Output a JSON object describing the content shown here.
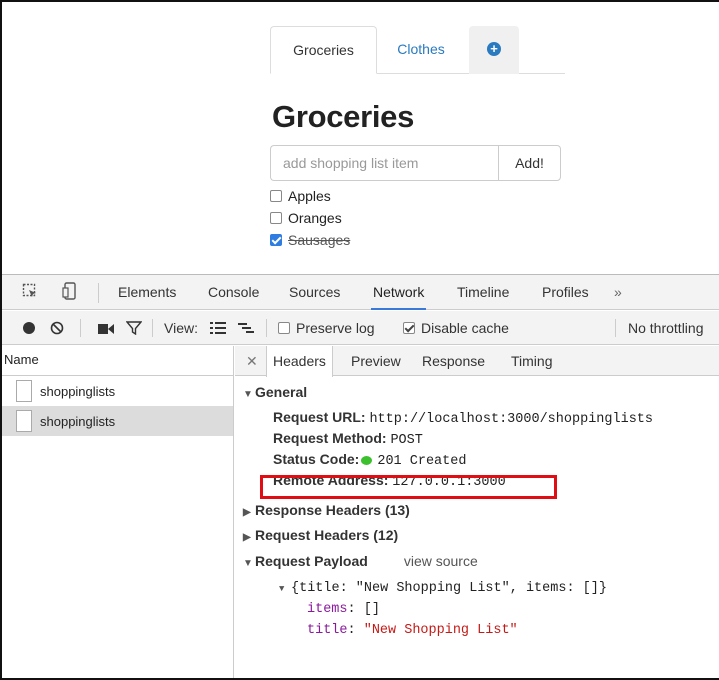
{
  "app": {
    "tabs": [
      {
        "label": "Groceries",
        "active": true
      },
      {
        "label": "Clothes",
        "active": false
      }
    ],
    "add_tab_icon": "plus-circle-icon",
    "title": "Groceries",
    "input_placeholder": "add shopping list item",
    "add_button": "Add!",
    "items": [
      {
        "label": "Apples",
        "checked": false
      },
      {
        "label": "Oranges",
        "checked": false
      },
      {
        "label": "Sausages",
        "checked": true
      }
    ]
  },
  "devtools": {
    "tabs": [
      "Elements",
      "Console",
      "Sources",
      "Network",
      "Timeline",
      "Profiles"
    ],
    "active_tab": "Network",
    "more_icon": "»",
    "toolbar": {
      "view_label": "View:",
      "preserve_log": {
        "label": "Preserve log",
        "checked": false
      },
      "disable_cache": {
        "label": "Disable cache",
        "checked": true
      },
      "throttling": "No throttling"
    },
    "name_header": "Name",
    "requests": [
      {
        "name": "shoppinglists",
        "selected": false
      },
      {
        "name": "shoppinglists",
        "selected": true
      }
    ],
    "detail_tabs": [
      "Headers",
      "Preview",
      "Response",
      "Timing"
    ],
    "active_detail_tab": "Headers",
    "general": {
      "title": "General",
      "request_url_label": "Request URL:",
      "request_url": "http://localhost:3000/shoppinglists",
      "request_method_label": "Request Method:",
      "request_method": "POST",
      "status_code_label": "Status Code:",
      "status_code": "201 Created",
      "status_color": "#3cc02d",
      "remote_address_label": "Remote Address:",
      "remote_address": "127.0.0.1:3000"
    },
    "response_headers": "Response Headers (13)",
    "request_headers": "Request Headers (12)",
    "payload": {
      "title": "Request Payload",
      "view_source": "view source",
      "summary": "{title: \"New Shopping List\", items: []}",
      "items_key": "items",
      "items_value": "[]",
      "title_key": "title",
      "title_value": "\"New Shopping List\""
    },
    "highlight_color": "#e10d14"
  }
}
